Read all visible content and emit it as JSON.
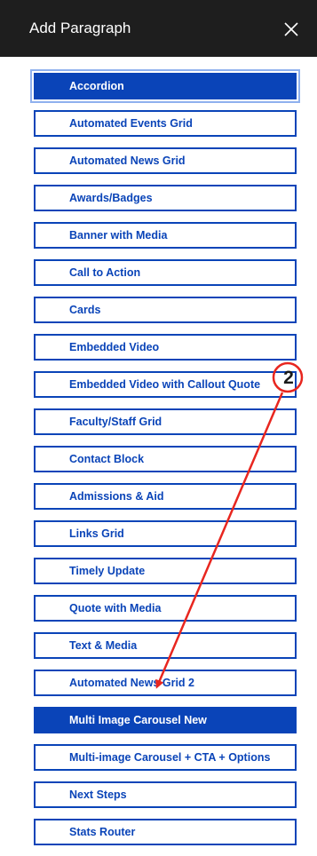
{
  "panel": {
    "title": "Add Paragraph",
    "close_icon": "close-icon"
  },
  "options": [
    {
      "label": "Accordion",
      "state": "focused"
    },
    {
      "label": "Automated Events Grid"
    },
    {
      "label": "Automated News Grid"
    },
    {
      "label": "Awards/Badges"
    },
    {
      "label": "Banner with Media"
    },
    {
      "label": "Call to Action"
    },
    {
      "label": "Cards"
    },
    {
      "label": "Embedded Video"
    },
    {
      "label": "Embedded Video with Callout Quote"
    },
    {
      "label": "Faculty/Staff Grid"
    },
    {
      "label": "Contact Block"
    },
    {
      "label": "Admissions & Aid"
    },
    {
      "label": "Links Grid"
    },
    {
      "label": "Timely Update"
    },
    {
      "label": "Quote with Media"
    },
    {
      "label": "Text & Media"
    },
    {
      "label": "Automated News Grid 2"
    },
    {
      "label": "Multi Image Carousel New",
      "state": "highlighted"
    },
    {
      "label": "Multi-image Carousel + CTA + Options"
    },
    {
      "label": "Next Steps"
    },
    {
      "label": "Stats Router"
    }
  ],
  "annotation": {
    "step_number": "2",
    "color": "#e8261f"
  },
  "colors": {
    "header_bg": "#1e1e1e",
    "primary": "#0a44b8",
    "focus_ring": "#8fb1ee",
    "annotation": "#e8261f"
  }
}
